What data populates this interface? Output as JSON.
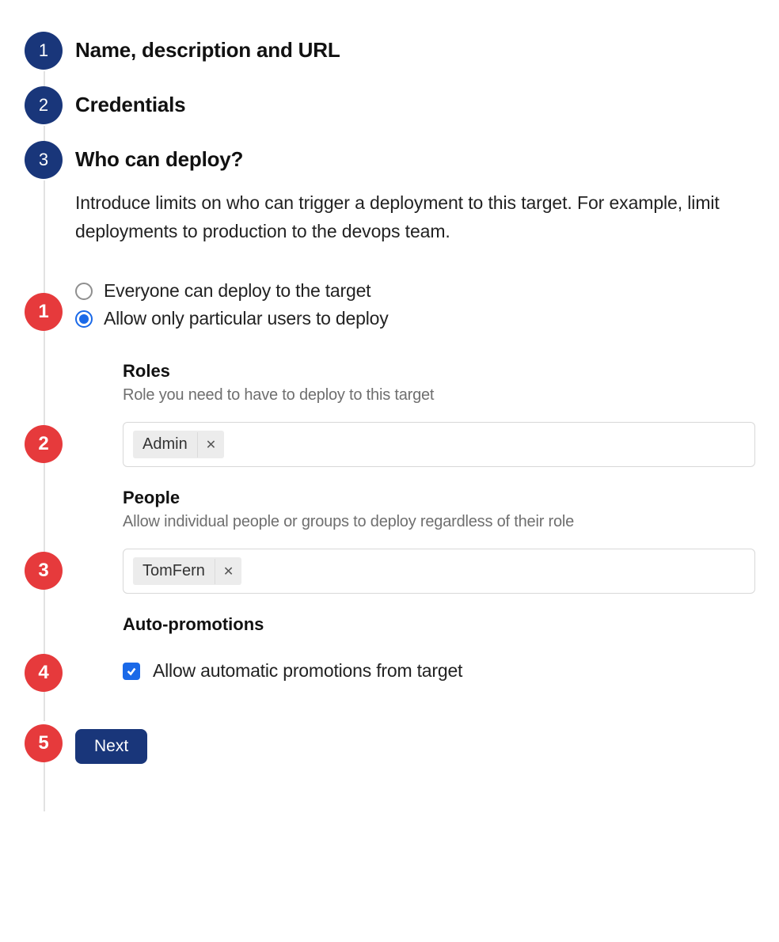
{
  "mainSteps": {
    "step1": {
      "num": "1",
      "title": "Name, description and URL"
    },
    "step2": {
      "num": "2",
      "title": "Credentials"
    },
    "step3": {
      "num": "3",
      "title": "Who can deploy?",
      "description": "Introduce limits on who can trigger a deployment to this target. For example, limit deployments to production to the devops team."
    }
  },
  "callouts": {
    "c1": "1",
    "c2": "2",
    "c3": "3",
    "c4": "4",
    "c5": "5"
  },
  "radios": {
    "everyone": "Everyone can deploy to the target",
    "particular": "Allow only particular users to deploy"
  },
  "roles": {
    "heading": "Roles",
    "sub": "Role you need to have to deploy to this target",
    "tag": "Admin"
  },
  "people": {
    "heading": "People",
    "sub": "Allow individual people or groups to deploy regardless of their role",
    "tag": "TomFern"
  },
  "autoPromotions": {
    "heading": "Auto-promotions",
    "checkboxLabel": "Allow automatic promotions from target"
  },
  "buttons": {
    "next": "Next"
  }
}
